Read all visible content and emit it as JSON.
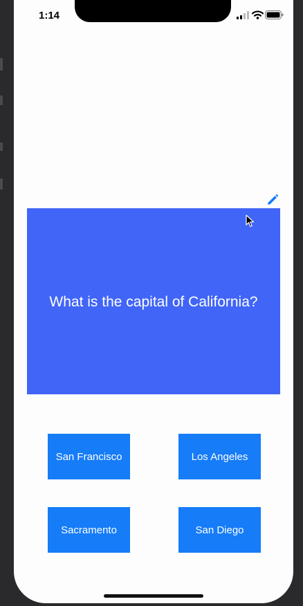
{
  "status_bar": {
    "time": "1:14",
    "icons": [
      "signal-icon",
      "wifi-icon",
      "battery-icon"
    ]
  },
  "question": {
    "text": "What is the capital of California?",
    "background_color": "#4165f7"
  },
  "toolbar": {
    "edit_icon": "pencil-icon",
    "accent_color": "#167cf8"
  },
  "answers": [
    {
      "label": "San Francisco"
    },
    {
      "label": "Los Angeles"
    },
    {
      "label": "Sacramento"
    },
    {
      "label": "San Diego"
    }
  ]
}
